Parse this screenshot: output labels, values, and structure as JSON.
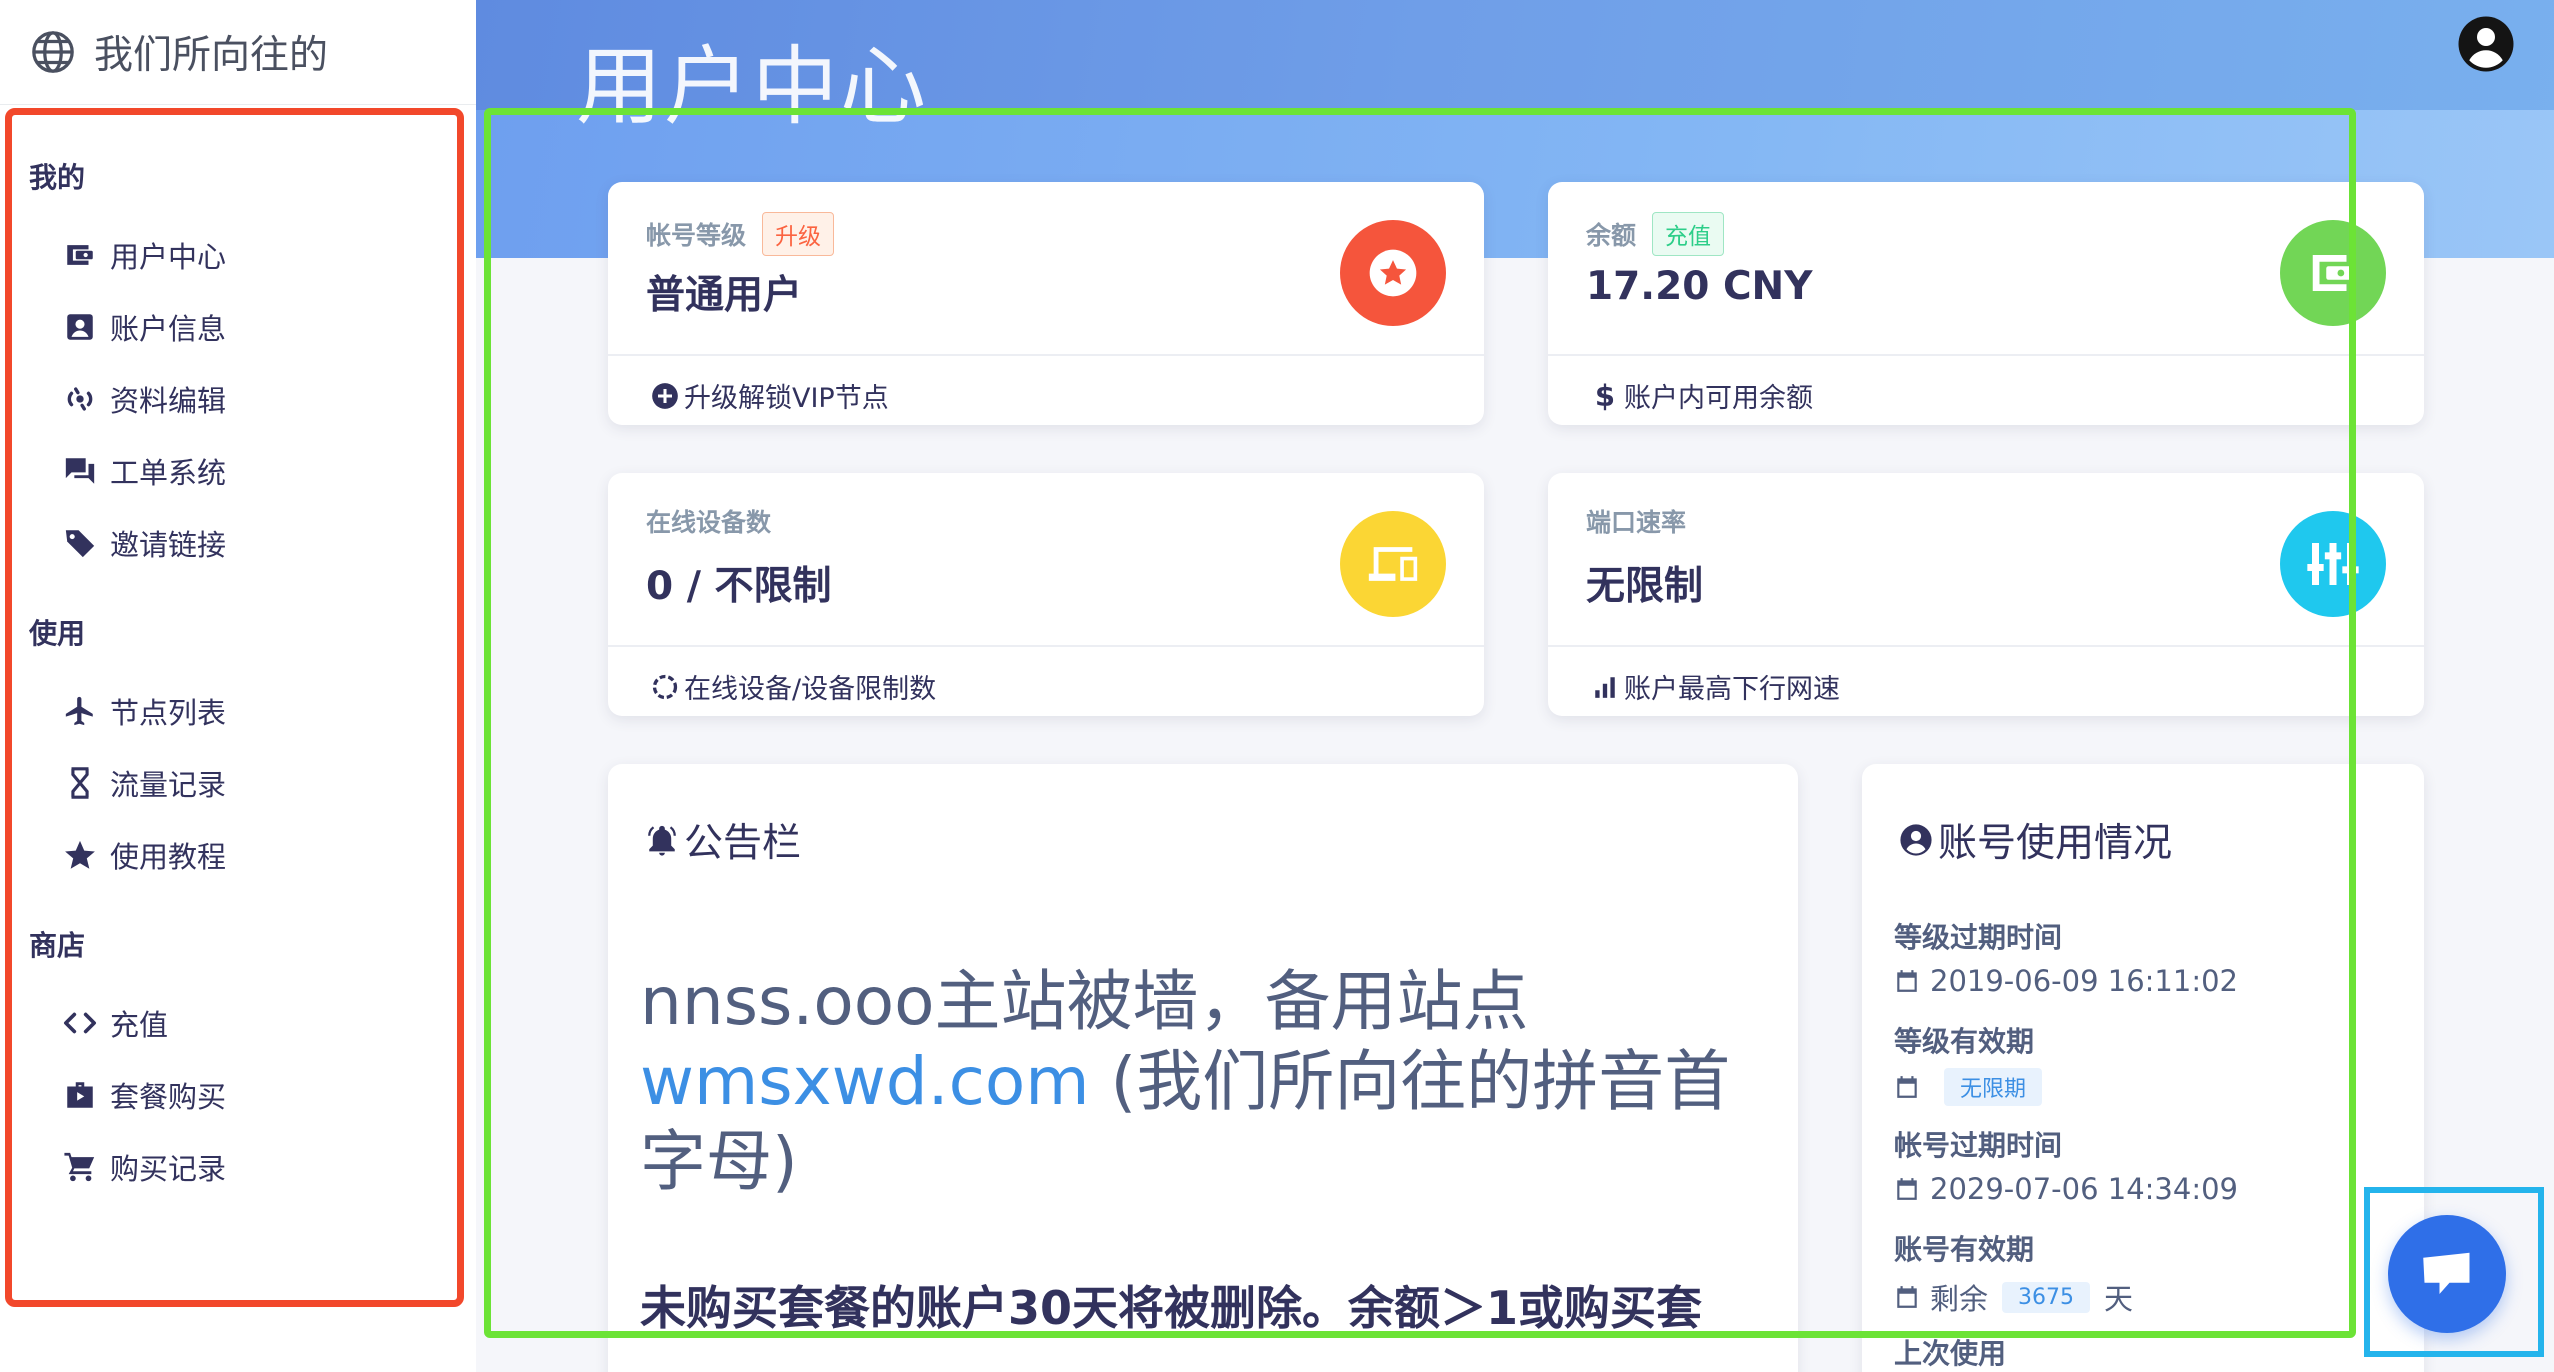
{
  "brand": {
    "title": "我们所向往的"
  },
  "header": {
    "page_title": "用户中心"
  },
  "sidebar": {
    "sections": [
      {
        "title": "我的",
        "items": [
          {
            "label": "用户中心",
            "icon": "dashboard-icon"
          },
          {
            "label": "账户信息",
            "icon": "account-box-icon"
          },
          {
            "label": "资料编辑",
            "icon": "edit-profile-icon"
          },
          {
            "label": "工单系统",
            "icon": "forum-icon"
          },
          {
            "label": "邀请链接",
            "icon": "tag-icon"
          }
        ]
      },
      {
        "title": "使用",
        "items": [
          {
            "label": "节点列表",
            "icon": "airplane-icon"
          },
          {
            "label": "流量记录",
            "icon": "hourglass-icon"
          },
          {
            "label": "使用教程",
            "icon": "star-icon"
          }
        ]
      },
      {
        "title": "商店",
        "items": [
          {
            "label": "充值",
            "icon": "code-icon"
          },
          {
            "label": "套餐购买",
            "icon": "shopping-bag-icon"
          },
          {
            "label": "购买记录",
            "icon": "shopping-cart-icon"
          }
        ]
      }
    ]
  },
  "cards": {
    "level": {
      "label": "帐号等级",
      "badge": "升级",
      "value": "普通用户",
      "footer": "升级解锁VIP节点",
      "icon_color": "#f5553c"
    },
    "balance": {
      "label": "余额",
      "badge": "充值",
      "value": "17.20 CNY",
      "footer": "账户内可用余额",
      "footer_symbol": "$",
      "icon_color": "#72d656"
    },
    "devices": {
      "label": "在线设备数",
      "value": "0 / 不限制",
      "footer": "在线设备/设备限制数",
      "icon_color": "#fbd634"
    },
    "speed": {
      "label": "端口速率",
      "value": "无限制",
      "footer": "账户最高下行网速",
      "icon_color": "#1fc8ee"
    }
  },
  "notice": {
    "title": "公告栏",
    "text_before": "nnss.ooo主站被墙，备用站点",
    "link": "wmsxwd.com",
    "text_after": " (我们所向往的拼音首字母)",
    "text2": "未购买套餐的账户30天将被删除。余额＞1或购买套"
  },
  "usage": {
    "title": "账号使用情况",
    "level_expire_label": "等级过期时间",
    "level_expire_value": "2019-06-09 16:11:02",
    "level_valid_label": "等级有效期",
    "level_valid_value": "无限期",
    "account_expire_label": "帐号过期时间",
    "account_expire_value": "2029-07-06 14:34:09",
    "account_valid_label": "账号有效期",
    "account_valid_prefix": "剩余",
    "account_valid_days": "3675",
    "account_valid_suffix": "天",
    "last_used_label": "上次使用"
  },
  "colors": {
    "annotation_red": "#f2482b",
    "annotation_green": "#6ce336",
    "annotation_blue": "#24b4ec",
    "accent": "#3c8fe4"
  }
}
